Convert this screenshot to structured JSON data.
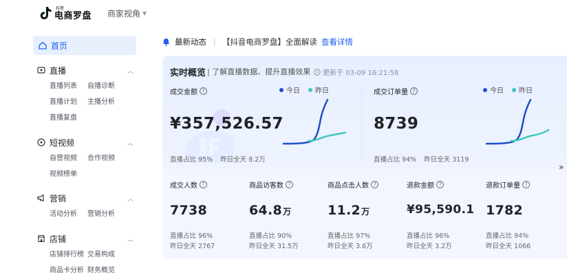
{
  "brand": {
    "small": "抖音",
    "main": "电商罗盘"
  },
  "role": "商家视角",
  "sidebar": {
    "home": "首页",
    "groups": [
      {
        "label": "直播",
        "icon": "live-icon",
        "items": [
          "直播列表",
          "自播诊断",
          "直播计划",
          "主播分析",
          "直播复盘"
        ]
      },
      {
        "label": "短视频",
        "icon": "video-icon",
        "items": [
          "自营视频",
          "合作视频",
          "视频榜单"
        ]
      },
      {
        "label": "营销",
        "icon": "megaphone-icon",
        "items": [
          "活动分析",
          "营销分析"
        ]
      },
      {
        "label": "店铺",
        "icon": "shop-icon",
        "items": [
          "店铺排行榜",
          "交易构成",
          "商品卡分析",
          "财务概览"
        ]
      }
    ]
  },
  "news": {
    "label": "最新动态",
    "text": "【抖音电商罗盘】全面解读",
    "link": "查看详情"
  },
  "overview": {
    "title": "实时概览",
    "subtitle": "| 了解直播数据、提升直播效果",
    "updated": "更新于 03-09 16:21:58",
    "legend_today": "今日",
    "legend_yesterday": "昨日",
    "colors": {
      "today": "#1e4fc8",
      "yesterday": "#3fc8c0"
    },
    "top": [
      {
        "label": "成交金额",
        "value": "¥357,526.57",
        "share": "直播占比 95%",
        "yesterday": "昨日全天 8.2万"
      },
      {
        "label": "成交订单量",
        "value": "8739",
        "share": "直播占比 94%",
        "yesterday": "昨日全天 3119"
      }
    ],
    "bottom": [
      {
        "label": "成交人数",
        "value": "7738",
        "unit": "",
        "share": "直播占比 96%",
        "yesterday": "昨日全天 2767"
      },
      {
        "label": "商品访客数",
        "value": "64.8",
        "unit": "万",
        "share": "直播占比 90%",
        "yesterday": "昨日全天 31.5万"
      },
      {
        "label": "商品点击人数",
        "value": "11.2",
        "unit": "万",
        "share": "直播占比 97%",
        "yesterday": "昨日全天 3.6万"
      },
      {
        "label": "退款金额",
        "value": "¥95,590.1",
        "unit": "",
        "share": "直播占比 96%",
        "yesterday": "昨日全天 3.2万"
      },
      {
        "label": "退款订单量",
        "value": "1782",
        "unit": "",
        "share": "直播占比 94%",
        "yesterday": "昨日全天 1066"
      }
    ]
  }
}
